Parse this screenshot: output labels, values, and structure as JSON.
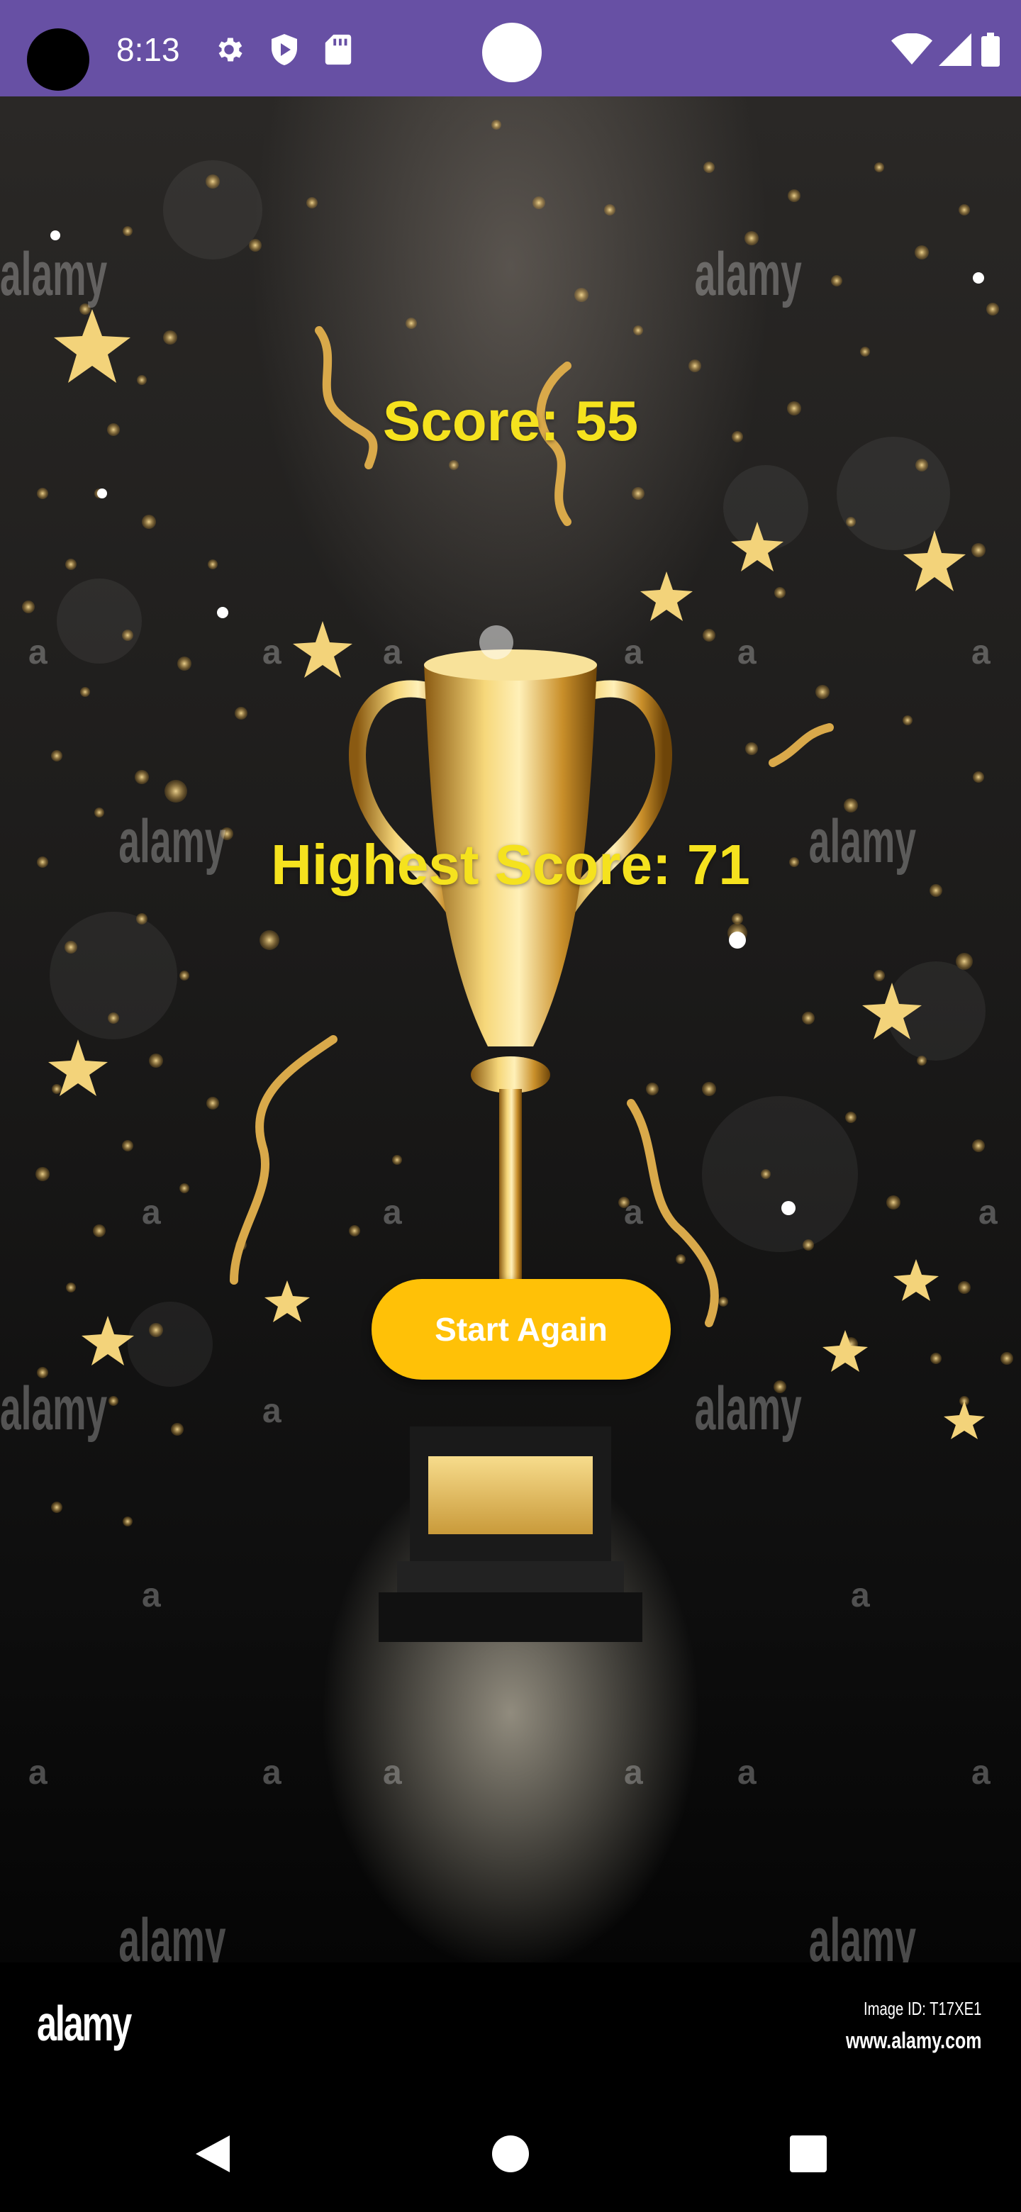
{
  "status_bar": {
    "time": "8:13",
    "icons": [
      "settings-icon",
      "shield-play-icon",
      "sd-card-icon",
      "wifi-icon",
      "signal-icon",
      "battery-icon"
    ],
    "background_color": "#6750a4"
  },
  "game_over": {
    "score_text": "Score: 55",
    "highest_score_text": "Highest Score: 71",
    "text_color": "#f5e21e",
    "start_again_label": "Start Again",
    "button_color": "#ffc107"
  },
  "watermark": {
    "logo": "alamy",
    "image_id": "Image ID: T17XE1",
    "url": "www.alamy.com"
  },
  "nav_bar": {
    "buttons": [
      "back-icon",
      "home-icon",
      "recents-icon"
    ]
  }
}
